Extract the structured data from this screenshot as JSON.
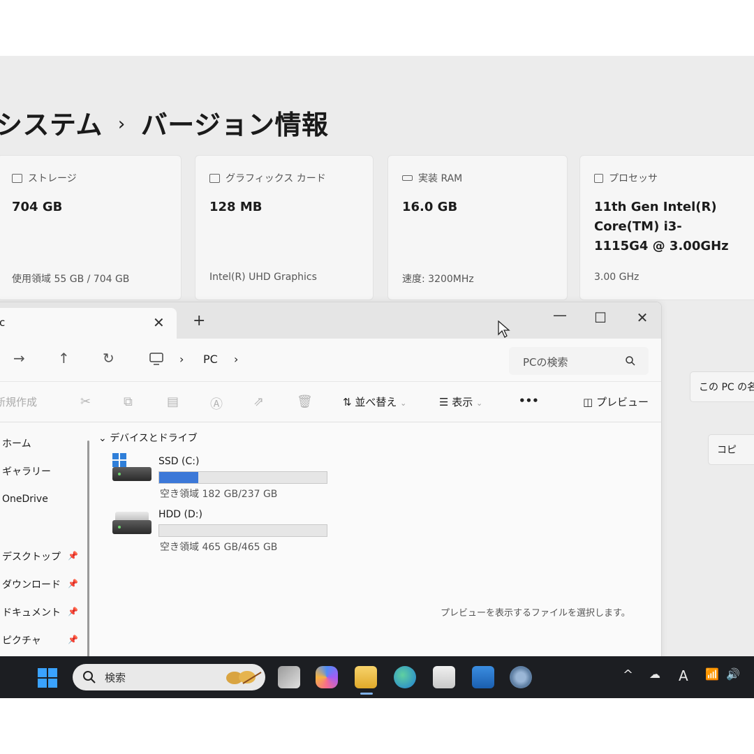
{
  "settings": {
    "breadcrumb_parent": "システム",
    "breadcrumb_sep": "›",
    "breadcrumb_current": "バージョン情報",
    "cards": [
      {
        "icon": "storage-icon",
        "label": "ストレージ",
        "value": "704 GB",
        "sub": "使用領域 55 GB / 704 GB"
      },
      {
        "icon": "graphics-card-icon",
        "label": "グラフィックス カード",
        "value": "128 MB",
        "sub": "Intel(R) UHD Graphics"
      },
      {
        "icon": "ram-icon",
        "label": "実装 RAM",
        "value": "16.0 GB",
        "sub": "速度: 3200MHz"
      },
      {
        "icon": "processor-icon",
        "label": "プロセッサ",
        "value": "11th Gen Intel(R) Core(TM) i3-1115G4 @ 3.00GHz",
        "sub": "3.00 GHz"
      }
    ],
    "rename_button": "この PC の名",
    "copy_button": "コピ"
  },
  "explorer": {
    "tab_label": "c",
    "tab_close": "✕",
    "new_tab": "+",
    "window_controls": {
      "minimize": "—",
      "maximize": "☐",
      "close": "✕"
    },
    "nav": {
      "forward": "→",
      "up": "↑",
      "refresh": "↻"
    },
    "address": {
      "sep": "›",
      "location": "PC"
    },
    "search_placeholder": "PCの検索",
    "toolbar": {
      "new": "新規作成",
      "sort": "並べ替え",
      "view": "表示",
      "more": "•••",
      "preview": "プレビュー"
    },
    "sidebar": [
      {
        "label": "ホーム",
        "pinned": false
      },
      {
        "label": "ギャラリー",
        "pinned": false
      },
      {
        "label": "OneDrive",
        "pinned": false
      },
      {
        "label": "デスクトップ",
        "pinned": true
      },
      {
        "label": "ダウンロード",
        "pinned": true
      },
      {
        "label": "ドキュメント",
        "pinned": true
      },
      {
        "label": "ピクチャ",
        "pinned": true
      }
    ],
    "group_header": "デバイスとドライブ",
    "drives": [
      {
        "name": "SSD (C:)",
        "free_text": "空き領域 182 GB/237 GB",
        "used_fraction": 0.232
      },
      {
        "name": "HDD (D:)",
        "free_text": "空き領域 465 GB/465 GB",
        "used_fraction": 0.0
      }
    ],
    "preview_message": "プレビューを表示するファイルを選択します。"
  },
  "taskbar": {
    "search_label": "検索",
    "apps": [
      "task-view-icon",
      "copilot-icon",
      "file-explorer-icon",
      "edge-icon",
      "store-icon",
      "outlook-icon",
      "settings-icon"
    ],
    "tray_ime": "A",
    "colors": {
      "accent": "#3c78d8",
      "taskbar": "#1c1e22"
    }
  }
}
